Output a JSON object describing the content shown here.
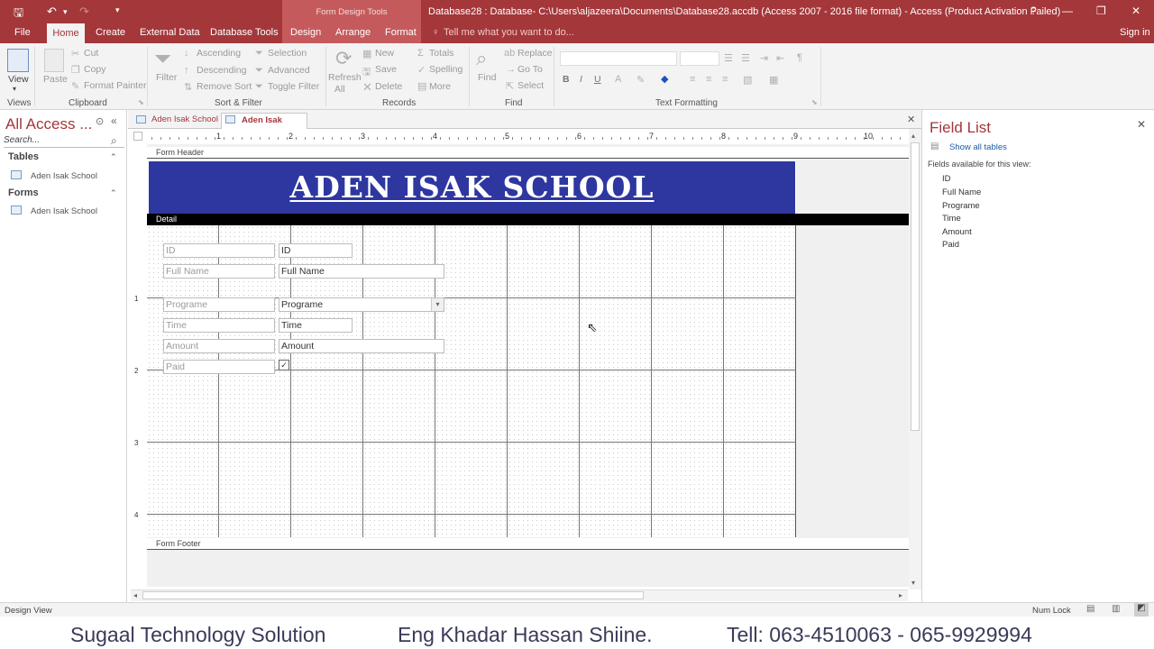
{
  "titlebar": {
    "context_label": "Form Design Tools",
    "window_title": "Database28 : Database- C:\\Users\\aljazeera\\Documents\\Database28.accdb (Access 2007 - 2016 file format) - Access (Product Activation Failed)",
    "help": "?",
    "minimize": "—",
    "restore": "❐",
    "close": "✕"
  },
  "ribbon_tabs": [
    "File",
    "Home",
    "Create",
    "External Data",
    "Database Tools",
    "Design",
    "Arrange",
    "Format"
  ],
  "tell_me": "Tell me what you want to do...",
  "sign_in": "Sign in",
  "ribbon": {
    "views": {
      "view": "View",
      "label": "Views"
    },
    "clipboard": {
      "paste": "Paste",
      "cut": "Cut",
      "copy": "Copy",
      "format_painter": "Format Painter",
      "label": "Clipboard"
    },
    "sort_filter": {
      "filter": "Filter",
      "ascending": "Ascending",
      "descending": "Descending",
      "remove_sort": "Remove Sort",
      "selection": "Selection",
      "advanced": "Advanced",
      "toggle_filter": "Toggle Filter",
      "label": "Sort & Filter"
    },
    "records": {
      "refresh": "Refresh",
      "refresh_all": "All",
      "new": "New",
      "save": "Save",
      "delete": "Delete",
      "totals": "Totals",
      "spelling": "Spelling",
      "more": "More",
      "label": "Records"
    },
    "find": {
      "find": "Find",
      "replace": "Replace",
      "goto": "Go To",
      "select": "Select",
      "label": "Find"
    },
    "text_formatting": {
      "bold": "B",
      "italic": "I",
      "underline": "U",
      "label": "Text Formatting"
    }
  },
  "nav": {
    "title": "All Access ...",
    "search_placeholder": "Search...",
    "tables_header": "Tables",
    "tables": [
      "Aden Isak School"
    ],
    "forms_header": "Forms",
    "forms": [
      "Aden Isak School"
    ]
  },
  "doc_tabs": [
    "Aden Isak School",
    "Aden Isak School"
  ],
  "ruler_numbers": [
    "1",
    "2",
    "3",
    "4",
    "5",
    "6",
    "7",
    "8",
    "9",
    "10"
  ],
  "vruler_numbers": [
    "1",
    "2",
    "3",
    "4"
  ],
  "form": {
    "header_section": "Form Header",
    "detail_section": "Detail",
    "footer_section": "Form Footer",
    "header_title": "ADEN ISAK SCHOOL",
    "fields": [
      {
        "label": "ID",
        "control": "ID"
      },
      {
        "label": "Full Name",
        "control": "Full Name"
      },
      {
        "label": "Programe",
        "control": "Programe"
      },
      {
        "label": "Time",
        "control": "Time"
      },
      {
        "label": "Amount",
        "control": "Amount"
      },
      {
        "label": "Paid",
        "control": "✓"
      }
    ]
  },
  "field_list": {
    "title": "Field List",
    "show_all": "Show all tables",
    "available": "Fields available for this view:",
    "fields": [
      "ID",
      "Full Name",
      "Programe",
      "Time",
      "Amount",
      "Paid"
    ]
  },
  "status": {
    "left": "Design View",
    "num_lock": "Num Lock"
  },
  "banner": {
    "company": "Sugaal Technology Solution",
    "author": "Eng Khadar Hassan Shiine.",
    "phone": "Tell: 063-4510063 - 065-9929994"
  }
}
